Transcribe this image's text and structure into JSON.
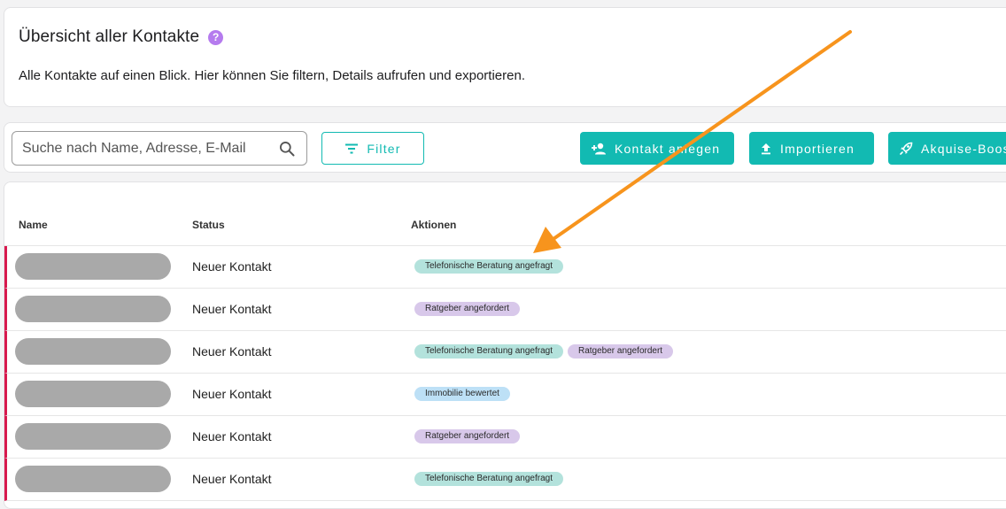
{
  "header": {
    "title": "Übersicht aller Kontakte",
    "help_glyph": "?",
    "subtitle": "Alle Kontakte auf einen Blick. Hier können Sie filtern, Details aufrufen und exportieren."
  },
  "toolbar": {
    "search_placeholder": "Suche nach Name, Adresse, E-Mail",
    "filter_label": "Filter",
    "add_contact_label": "Kontakt anlegen",
    "import_label": "Importieren",
    "boost_label": "Akquise-Boost"
  },
  "table": {
    "columns": [
      "Name",
      "Status",
      "Aktionen"
    ],
    "rows": [
      {
        "status": "Neuer Kontakt",
        "actions": [
          {
            "label": "Telefonische Beratung angefragt",
            "kind": "teal"
          }
        ]
      },
      {
        "status": "Neuer Kontakt",
        "actions": [
          {
            "label": "Ratgeber angefordert",
            "kind": "purple"
          }
        ]
      },
      {
        "status": "Neuer Kontakt",
        "actions": [
          {
            "label": "Telefonische Beratung angefragt",
            "kind": "teal"
          },
          {
            "label": "Ratgeber angefordert",
            "kind": "purple"
          }
        ]
      },
      {
        "status": "Neuer Kontakt",
        "actions": [
          {
            "label": "Immobilie bewertet",
            "kind": "blue"
          }
        ]
      },
      {
        "status": "Neuer Kontakt",
        "actions": [
          {
            "label": "Ratgeber angefordert",
            "kind": "purple"
          }
        ]
      },
      {
        "status": "Neuer Kontakt",
        "actions": [
          {
            "label": "Telefonische Beratung angefragt",
            "kind": "teal"
          }
        ]
      }
    ]
  },
  "colors": {
    "accent": "#12bab2",
    "row_marker": "#d8194e",
    "help": "#b57bee",
    "annotation_arrow": "#f7941d"
  },
  "icons": {
    "help": "help-circle-icon",
    "search": "magnifier-icon",
    "filter": "filter-lines-icon",
    "add_contact": "person-add-icon",
    "import": "upload-icon",
    "boost": "rocket-icon"
  }
}
